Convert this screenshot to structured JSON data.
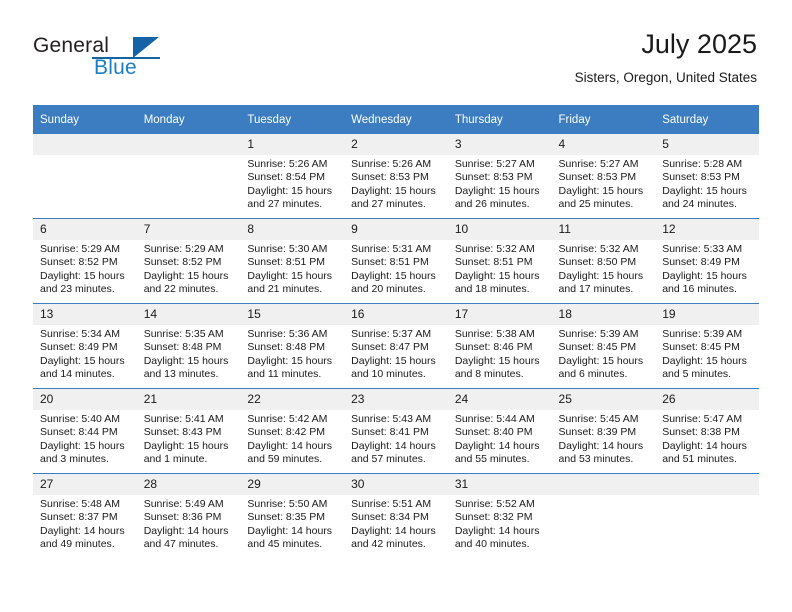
{
  "brand": {
    "name_part1": "General",
    "name_part2": "Blue",
    "accent_color": "#1363a5",
    "text_color": "#231f20"
  },
  "header": {
    "title": "July 2025",
    "subtitle": "Sisters, Oregon, United States"
  },
  "theme": {
    "header_bg": "#3b7dc0",
    "daynum_bg": "#f0f0f0",
    "grid_line": "#3b7dc0"
  },
  "weekdays": [
    "Sunday",
    "Monday",
    "Tuesday",
    "Wednesday",
    "Thursday",
    "Friday",
    "Saturday"
  ],
  "labels": {
    "sunrise": "Sunrise:",
    "sunset": "Sunset:",
    "daylight": "Daylight:"
  },
  "weeks": [
    [
      {
        "day": "",
        "blank": true,
        "sunrise": "",
        "sunset": "",
        "daylight_line1": "",
        "daylight_line2": ""
      },
      {
        "day": "",
        "blank": true,
        "sunrise": "",
        "sunset": "",
        "daylight_line1": "",
        "daylight_line2": ""
      },
      {
        "day": "1",
        "sunrise": "Sunrise: 5:26 AM",
        "sunset": "Sunset: 8:54 PM",
        "daylight_line1": "Daylight: 15 hours",
        "daylight_line2": "and 27 minutes."
      },
      {
        "day": "2",
        "sunrise": "Sunrise: 5:26 AM",
        "sunset": "Sunset: 8:53 PM",
        "daylight_line1": "Daylight: 15 hours",
        "daylight_line2": "and 27 minutes."
      },
      {
        "day": "3",
        "sunrise": "Sunrise: 5:27 AM",
        "sunset": "Sunset: 8:53 PM",
        "daylight_line1": "Daylight: 15 hours",
        "daylight_line2": "and 26 minutes."
      },
      {
        "day": "4",
        "sunrise": "Sunrise: 5:27 AM",
        "sunset": "Sunset: 8:53 PM",
        "daylight_line1": "Daylight: 15 hours",
        "daylight_line2": "and 25 minutes."
      },
      {
        "day": "5",
        "sunrise": "Sunrise: 5:28 AM",
        "sunset": "Sunset: 8:53 PM",
        "daylight_line1": "Daylight: 15 hours",
        "daylight_line2": "and 24 minutes."
      }
    ],
    [
      {
        "day": "6",
        "sunrise": "Sunrise: 5:29 AM",
        "sunset": "Sunset: 8:52 PM",
        "daylight_line1": "Daylight: 15 hours",
        "daylight_line2": "and 23 minutes."
      },
      {
        "day": "7",
        "sunrise": "Sunrise: 5:29 AM",
        "sunset": "Sunset: 8:52 PM",
        "daylight_line1": "Daylight: 15 hours",
        "daylight_line2": "and 22 minutes."
      },
      {
        "day": "8",
        "sunrise": "Sunrise: 5:30 AM",
        "sunset": "Sunset: 8:51 PM",
        "daylight_line1": "Daylight: 15 hours",
        "daylight_line2": "and 21 minutes."
      },
      {
        "day": "9",
        "sunrise": "Sunrise: 5:31 AM",
        "sunset": "Sunset: 8:51 PM",
        "daylight_line1": "Daylight: 15 hours",
        "daylight_line2": "and 20 minutes."
      },
      {
        "day": "10",
        "sunrise": "Sunrise: 5:32 AM",
        "sunset": "Sunset: 8:51 PM",
        "daylight_line1": "Daylight: 15 hours",
        "daylight_line2": "and 18 minutes."
      },
      {
        "day": "11",
        "sunrise": "Sunrise: 5:32 AM",
        "sunset": "Sunset: 8:50 PM",
        "daylight_line1": "Daylight: 15 hours",
        "daylight_line2": "and 17 minutes."
      },
      {
        "day": "12",
        "sunrise": "Sunrise: 5:33 AM",
        "sunset": "Sunset: 8:49 PM",
        "daylight_line1": "Daylight: 15 hours",
        "daylight_line2": "and 16 minutes."
      }
    ],
    [
      {
        "day": "13",
        "sunrise": "Sunrise: 5:34 AM",
        "sunset": "Sunset: 8:49 PM",
        "daylight_line1": "Daylight: 15 hours",
        "daylight_line2": "and 14 minutes."
      },
      {
        "day": "14",
        "sunrise": "Sunrise: 5:35 AM",
        "sunset": "Sunset: 8:48 PM",
        "daylight_line1": "Daylight: 15 hours",
        "daylight_line2": "and 13 minutes."
      },
      {
        "day": "15",
        "sunrise": "Sunrise: 5:36 AM",
        "sunset": "Sunset: 8:48 PM",
        "daylight_line1": "Daylight: 15 hours",
        "daylight_line2": "and 11 minutes."
      },
      {
        "day": "16",
        "sunrise": "Sunrise: 5:37 AM",
        "sunset": "Sunset: 8:47 PM",
        "daylight_line1": "Daylight: 15 hours",
        "daylight_line2": "and 10 minutes."
      },
      {
        "day": "17",
        "sunrise": "Sunrise: 5:38 AM",
        "sunset": "Sunset: 8:46 PM",
        "daylight_line1": "Daylight: 15 hours",
        "daylight_line2": "and 8 minutes."
      },
      {
        "day": "18",
        "sunrise": "Sunrise: 5:39 AM",
        "sunset": "Sunset: 8:45 PM",
        "daylight_line1": "Daylight: 15 hours",
        "daylight_line2": "and 6 minutes."
      },
      {
        "day": "19",
        "sunrise": "Sunrise: 5:39 AM",
        "sunset": "Sunset: 8:45 PM",
        "daylight_line1": "Daylight: 15 hours",
        "daylight_line2": "and 5 minutes."
      }
    ],
    [
      {
        "day": "20",
        "sunrise": "Sunrise: 5:40 AM",
        "sunset": "Sunset: 8:44 PM",
        "daylight_line1": "Daylight: 15 hours",
        "daylight_line2": "and 3 minutes."
      },
      {
        "day": "21",
        "sunrise": "Sunrise: 5:41 AM",
        "sunset": "Sunset: 8:43 PM",
        "daylight_line1": "Daylight: 15 hours",
        "daylight_line2": "and 1 minute."
      },
      {
        "day": "22",
        "sunrise": "Sunrise: 5:42 AM",
        "sunset": "Sunset: 8:42 PM",
        "daylight_line1": "Daylight: 14 hours",
        "daylight_line2": "and 59 minutes."
      },
      {
        "day": "23",
        "sunrise": "Sunrise: 5:43 AM",
        "sunset": "Sunset: 8:41 PM",
        "daylight_line1": "Daylight: 14 hours",
        "daylight_line2": "and 57 minutes."
      },
      {
        "day": "24",
        "sunrise": "Sunrise: 5:44 AM",
        "sunset": "Sunset: 8:40 PM",
        "daylight_line1": "Daylight: 14 hours",
        "daylight_line2": "and 55 minutes."
      },
      {
        "day": "25",
        "sunrise": "Sunrise: 5:45 AM",
        "sunset": "Sunset: 8:39 PM",
        "daylight_line1": "Daylight: 14 hours",
        "daylight_line2": "and 53 minutes."
      },
      {
        "day": "26",
        "sunrise": "Sunrise: 5:47 AM",
        "sunset": "Sunset: 8:38 PM",
        "daylight_line1": "Daylight: 14 hours",
        "daylight_line2": "and 51 minutes."
      }
    ],
    [
      {
        "day": "27",
        "sunrise": "Sunrise: 5:48 AM",
        "sunset": "Sunset: 8:37 PM",
        "daylight_line1": "Daylight: 14 hours",
        "daylight_line2": "and 49 minutes."
      },
      {
        "day": "28",
        "sunrise": "Sunrise: 5:49 AM",
        "sunset": "Sunset: 8:36 PM",
        "daylight_line1": "Daylight: 14 hours",
        "daylight_line2": "and 47 minutes."
      },
      {
        "day": "29",
        "sunrise": "Sunrise: 5:50 AM",
        "sunset": "Sunset: 8:35 PM",
        "daylight_line1": "Daylight: 14 hours",
        "daylight_line2": "and 45 minutes."
      },
      {
        "day": "30",
        "sunrise": "Sunrise: 5:51 AM",
        "sunset": "Sunset: 8:34 PM",
        "daylight_line1": "Daylight: 14 hours",
        "daylight_line2": "and 42 minutes."
      },
      {
        "day": "31",
        "sunrise": "Sunrise: 5:52 AM",
        "sunset": "Sunset: 8:32 PM",
        "daylight_line1": "Daylight: 14 hours",
        "daylight_line2": "and 40 minutes."
      },
      {
        "day": "",
        "blank": true,
        "sunrise": "",
        "sunset": "",
        "daylight_line1": "",
        "daylight_line2": ""
      },
      {
        "day": "",
        "blank": true,
        "sunrise": "",
        "sunset": "",
        "daylight_line1": "",
        "daylight_line2": ""
      }
    ]
  ]
}
